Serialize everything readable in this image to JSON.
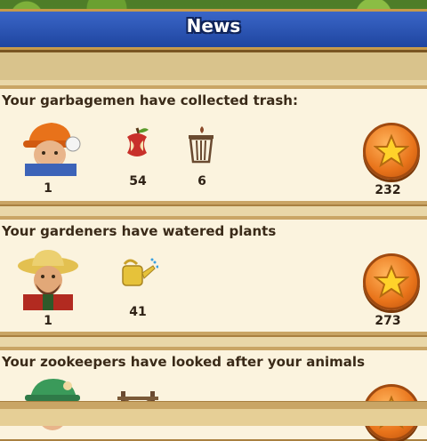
{
  "header": {
    "title": "News"
  },
  "cards": [
    {
      "title": "Your garbagemen have collected trash:",
      "worker_count": "1",
      "stats": [
        "54",
        "6"
      ],
      "reward": "232",
      "icons": [
        "garbageman-portrait-icon",
        "apple-core-icon",
        "trash-can-icon",
        "star-icon"
      ]
    },
    {
      "title": "Your gardeners have watered plants",
      "worker_count": "1",
      "stats": [
        "41"
      ],
      "reward": "273",
      "icons": [
        "gardener-portrait-icon",
        "watering-can-icon",
        "star-icon"
      ]
    },
    {
      "title": "Your zookeepers have looked after your animals",
      "icons": [
        "zookeeper-portrait-icon",
        "fence-icon",
        "star-icon"
      ]
    }
  ],
  "colors": {
    "ribbon": "#2a55b8",
    "card": "#fbf3de",
    "border": "#c9a565",
    "star_button": "#e8731a"
  }
}
